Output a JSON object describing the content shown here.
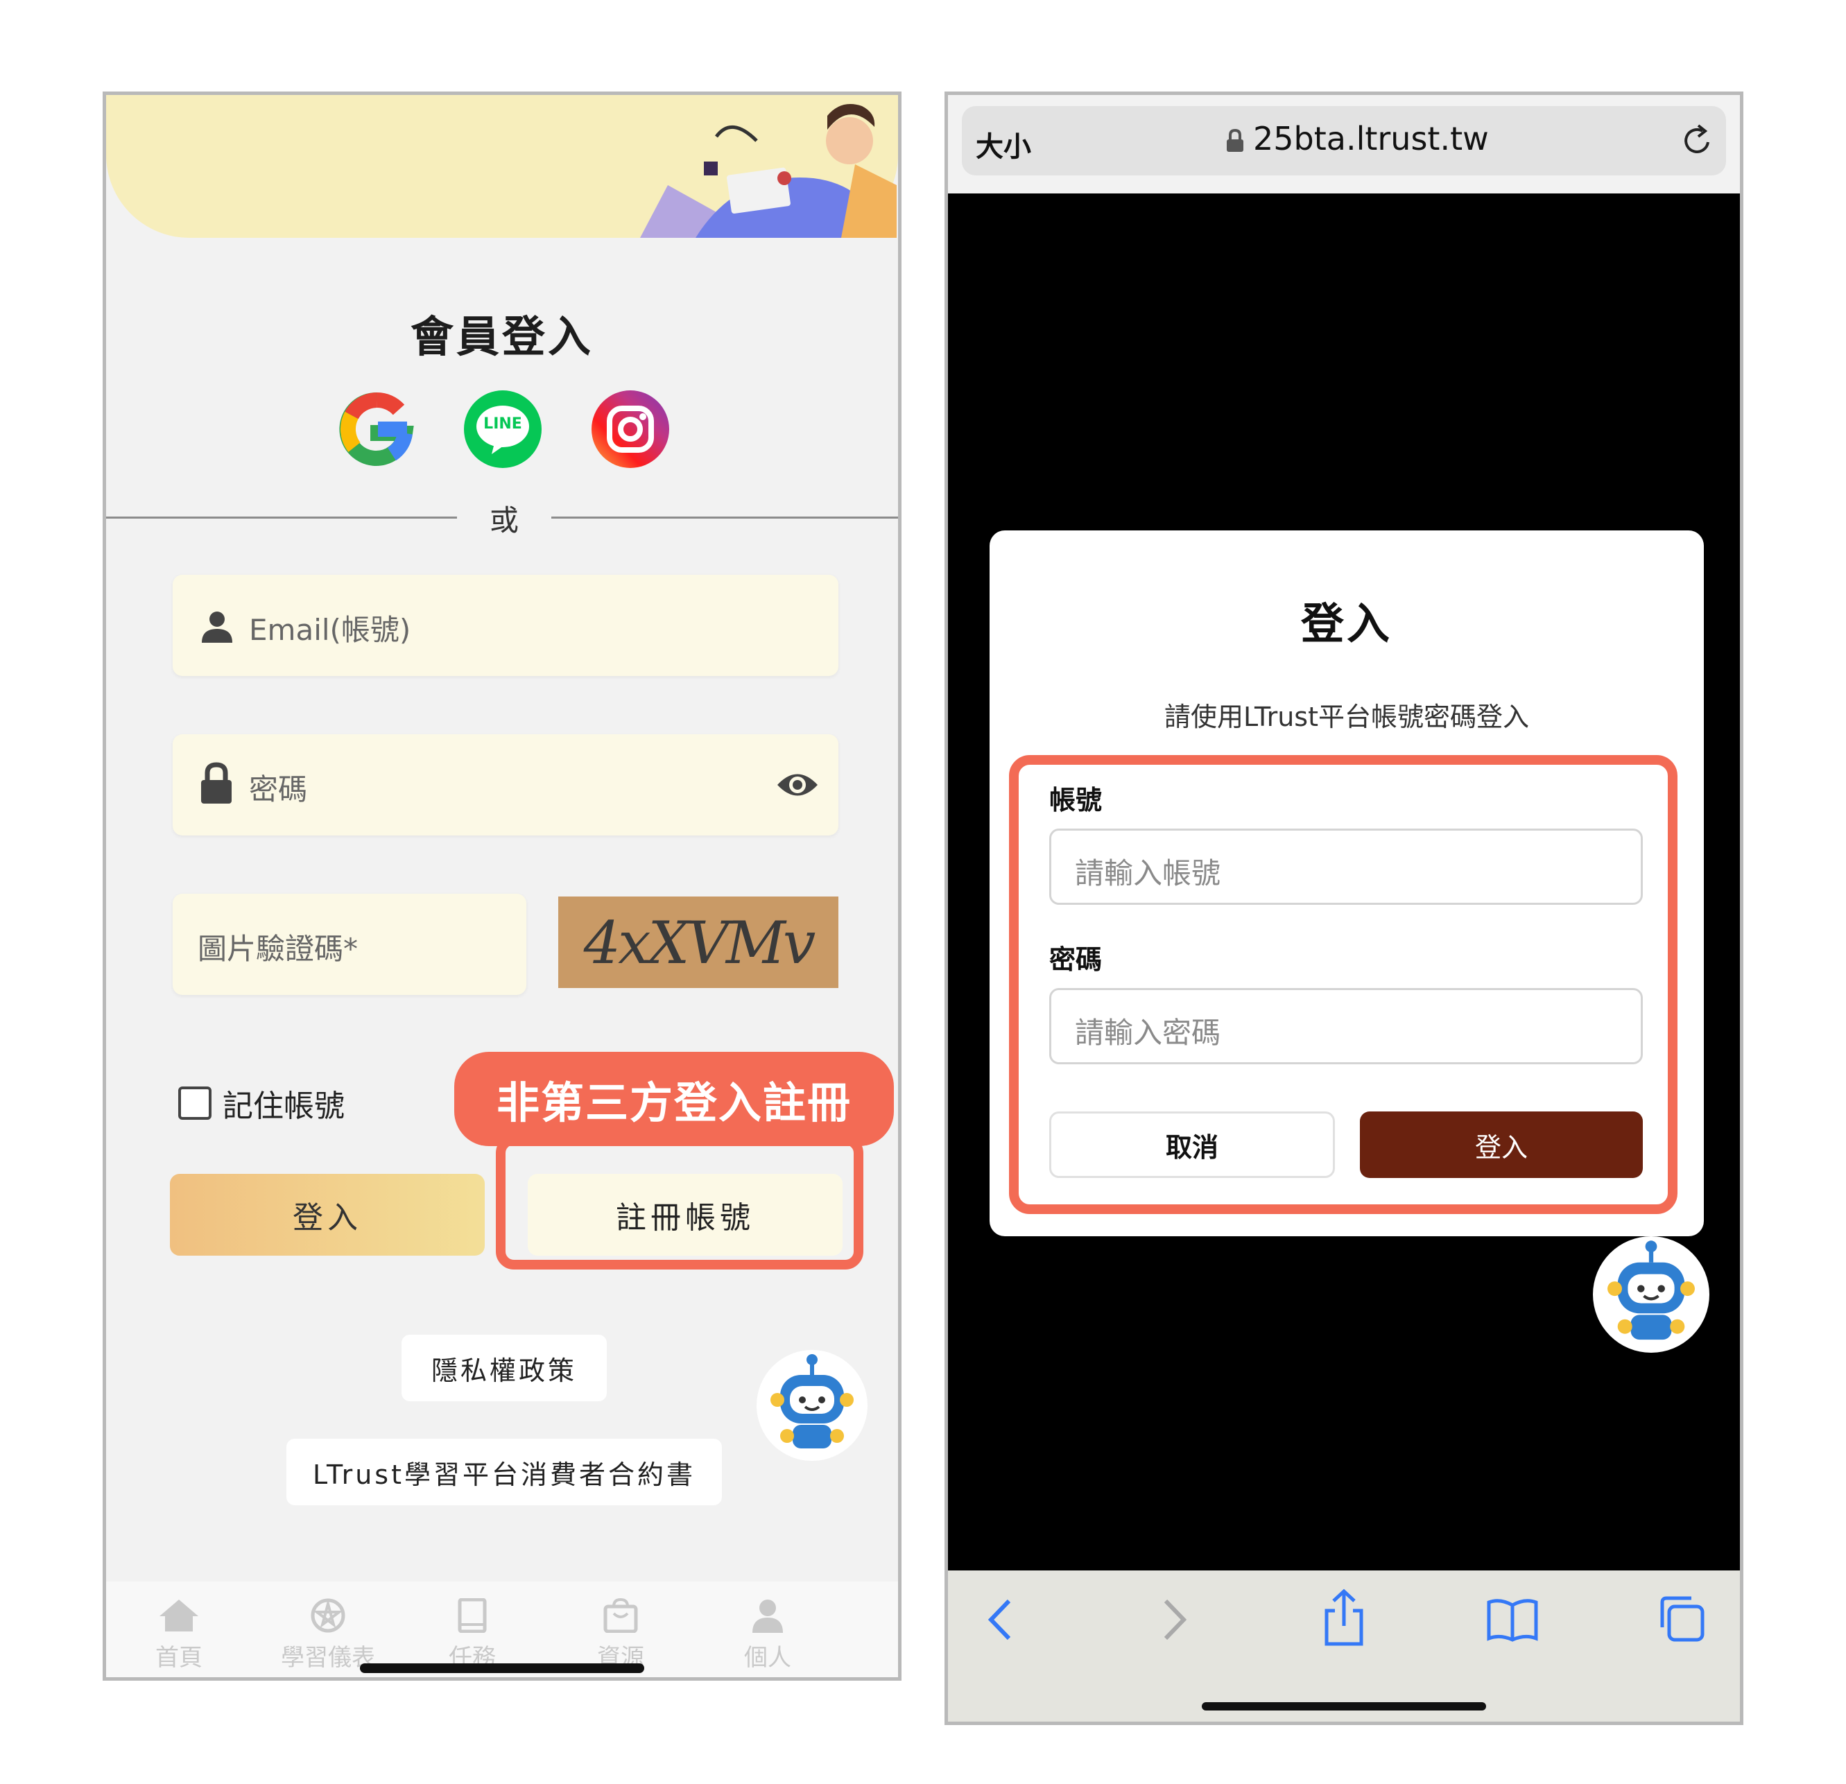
{
  "left_screen": {
    "title": "會員登入",
    "social_logins": [
      {
        "name": "google",
        "icon": "google-icon"
      },
      {
        "name": "line",
        "icon": "line-icon",
        "text": "LINE"
      },
      {
        "name": "instagram",
        "icon": "instagram-icon"
      }
    ],
    "divider_text": "或",
    "email_placeholder": "Email(帳號)",
    "password_placeholder": "密碼",
    "captcha_placeholder": "圖片驗證碼*",
    "captcha_code": "4xXVMv",
    "remember_label": "記住帳號",
    "callout_text": "非第三方登入註冊",
    "login_button": "登入",
    "register_button": "註冊帳號",
    "privacy_link": "隱私權政策",
    "agreement_link": "LTrust學習平台消費者合約書",
    "tabs": [
      {
        "label": "首頁",
        "icon": "home-icon"
      },
      {
        "label": "學習儀表",
        "icon": "dashboard-icon"
      },
      {
        "label": "任務",
        "icon": "book-icon"
      },
      {
        "label": "資源",
        "icon": "bag-icon"
      },
      {
        "label": "個人",
        "icon": "person-icon"
      }
    ]
  },
  "right_screen": {
    "text_size_label": "大小",
    "url": "25bta.ltrust.tw",
    "dialog": {
      "title": "登入",
      "subtitle": "請使用LTrust平台帳號密碼登入",
      "account_label": "帳號",
      "account_placeholder": "請輸入帳號",
      "password_label": "密碼",
      "password_placeholder": "請輸入密碼",
      "cancel_button": "取消",
      "login_button": "登入"
    }
  },
  "colors": {
    "highlight": "#f36b55",
    "banner": "#f7eebc",
    "field_bg": "#fcf9e6",
    "primary_dark": "#6a220f",
    "safari_blue": "#3478f6"
  }
}
